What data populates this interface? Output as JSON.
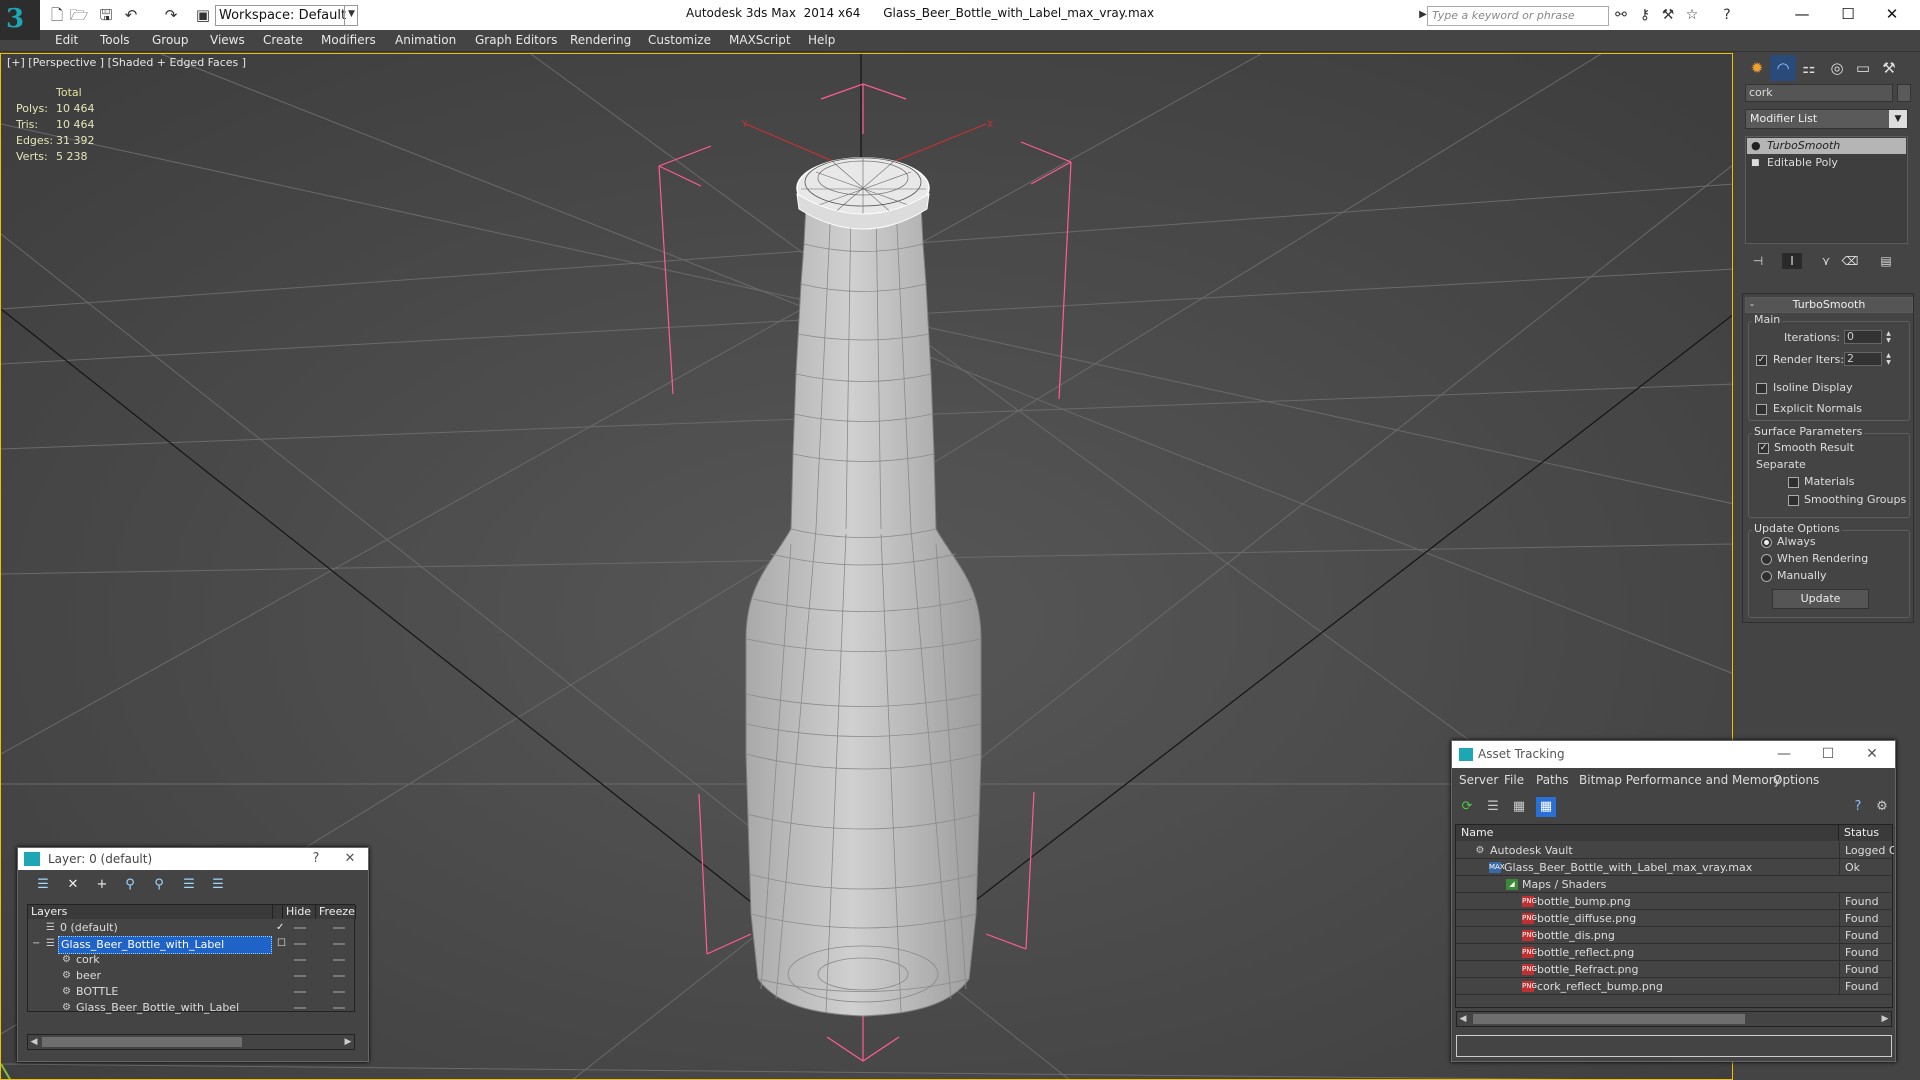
{
  "titlebar": {
    "app_title": "Autodesk 3ds Max  2014 x64",
    "file_title": "Glass_Beer_Bottle_with_Label_max_vray.max",
    "workspace": "Workspace: Default",
    "search_placeholder": "Type a keyword or phrase"
  },
  "menu": [
    "Edit",
    "Tools",
    "Group",
    "Views",
    "Create",
    "Modifiers",
    "Animation",
    "Graph Editors",
    "Rendering",
    "Customize",
    "MAXScript",
    "Help"
  ],
  "viewport": {
    "label": "[+] [Perspective ] [Shaded + Edged Faces ]",
    "stats_header": "Total",
    "stats": [
      {
        "label": "Polys:",
        "value": "10 464"
      },
      {
        "label": "Tris:",
        "value": "10 464"
      },
      {
        "label": "Edges:",
        "value": "31 392"
      },
      {
        "label": "Verts:",
        "value": "5 238"
      }
    ]
  },
  "command_panel": {
    "object_name": "cork",
    "modifier_list": "Modifier List",
    "stack": [
      "TurboSmooth",
      "Editable Poly"
    ],
    "rollout_title": "TurboSmooth",
    "main_group": "Main",
    "iterations_label": "Iterations:",
    "iterations_value": "0",
    "render_iters_label": "Render Iters:",
    "render_iters_value": "2",
    "isoline_label": "Isoline Display",
    "explicit_normals_label": "Explicit Normals",
    "surface_group": "Surface Parameters",
    "smooth_result_label": "Smooth Result",
    "separate_label": "Separate",
    "materials_label": "Materials",
    "smoothing_groups_label": "Smoothing Groups",
    "update_group": "Update Options",
    "always_label": "Always",
    "when_rendering_label": "When Rendering",
    "manually_label": "Manually",
    "update_button": "Update"
  },
  "layer_window": {
    "title": "Layer: 0 (default)",
    "col_layers": "Layers",
    "col_hide": "Hide",
    "col_freeze": "Freeze",
    "rows": [
      {
        "name": "0 (default)",
        "indent": 0
      },
      {
        "name": "Glass_Beer_Bottle_with_Label",
        "indent": 0
      },
      {
        "name": "cork",
        "indent": 1
      },
      {
        "name": "beer",
        "indent": 1
      },
      {
        "name": "BOTTLE",
        "indent": 1
      },
      {
        "name": "Glass_Beer_Bottle_with_Label",
        "indent": 1
      }
    ]
  },
  "asset_window": {
    "title": "Asset Tracking",
    "menu": [
      "Server",
      "File",
      "Paths",
      "Bitmap Performance and Memory",
      "Options"
    ],
    "col_name": "Name",
    "col_status": "Status",
    "rows": [
      {
        "name": "Autodesk Vault",
        "status": "Logged O",
        "level": 0,
        "icon": "vault-icon"
      },
      {
        "name": "Glass_Beer_Bottle_with_Label_max_vray.max",
        "status": "Ok",
        "level": 1,
        "icon": "max-file-icon"
      },
      {
        "name": "Maps / Shaders",
        "status": "",
        "level": 2,
        "icon": "maps-icon"
      },
      {
        "name": "bottle_bump.png",
        "status": "Found",
        "level": 3,
        "icon": "png-icon"
      },
      {
        "name": "bottle_diffuse.png",
        "status": "Found",
        "level": 3,
        "icon": "png-icon"
      },
      {
        "name": "bottle_dis.png",
        "status": "Found",
        "level": 3,
        "icon": "png-icon"
      },
      {
        "name": "bottle_reflect.png",
        "status": "Found",
        "level": 3,
        "icon": "png-icon"
      },
      {
        "name": "bottle_Refract.png",
        "status": "Found",
        "level": 3,
        "icon": "png-icon"
      },
      {
        "name": "cork_reflect_bump.png",
        "status": "Found",
        "level": 3,
        "icon": "png-icon"
      }
    ]
  },
  "colors": {
    "accent": "#1da7b5",
    "selection": "#1f63c8",
    "viewport_bg": "#4b4b4b",
    "gizmo": "#ff4d88"
  }
}
